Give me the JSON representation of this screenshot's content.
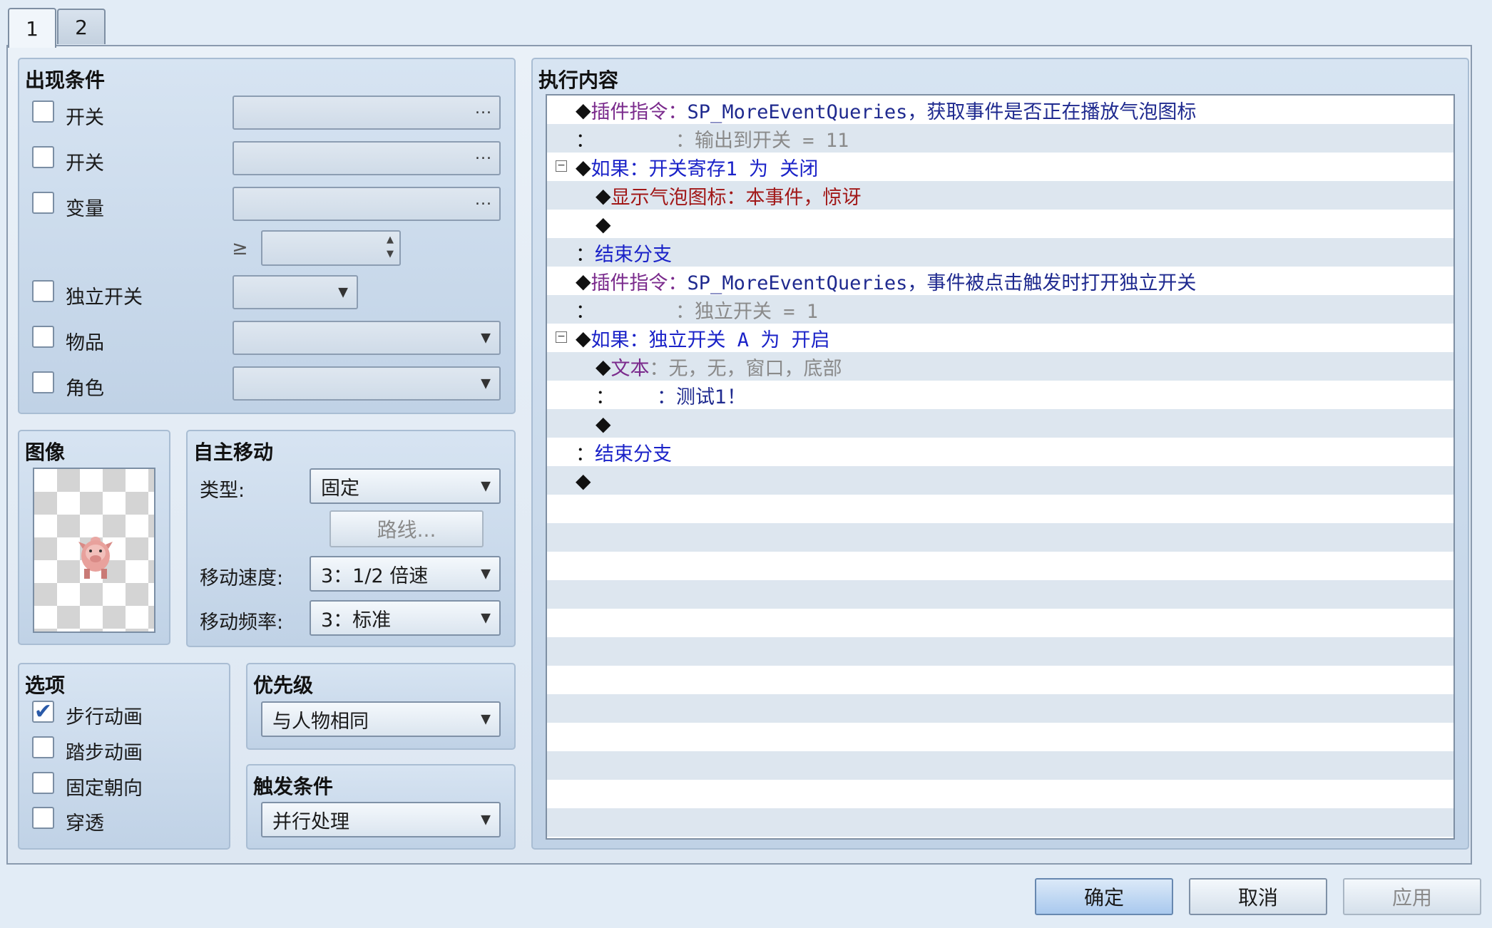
{
  "tabs": [
    "1",
    "2"
  ],
  "conditions": {
    "title": "出现条件",
    "switch1_label": "开关",
    "switch2_label": "开关",
    "variable_label": "变量",
    "ge_symbol": "≥",
    "self_switch_label": "独立开关",
    "item_label": "物品",
    "actor_label": "角色",
    "ellipsis": "..."
  },
  "image": {
    "title": "图像"
  },
  "autonomous": {
    "title": "自主移动",
    "type_label": "类型:",
    "type_value": "固定",
    "route_button": "路线...",
    "speed_label": "移动速度:",
    "speed_value": "3：1/2 倍速",
    "freq_label": "移动频率:",
    "freq_value": "3：标准"
  },
  "options": {
    "title": "选项",
    "walking": "步行动画",
    "walking_checked": "✔",
    "stepping": "踏步动画",
    "direction_fix": "固定朝向",
    "through": "穿透"
  },
  "priority": {
    "title": "优先级",
    "value": "与人物相同"
  },
  "trigger": {
    "title": "触发条件",
    "value": "并行处理"
  },
  "contents": {
    "title": "执行内容",
    "r1_cmd": "插件指令：",
    "r1_text": "SP_MoreEventQueries，获取事件是否正在播放气泡图标",
    "r2_colon": "：",
    "r2_text": "：输出到开关 = 11",
    "r3_cmd": "如果：",
    "r3_text": "开关寄存1 为 关闭",
    "r4_cmd": "显示气泡图标：",
    "r4_text": "本事件，惊讶",
    "r6_colon": "：",
    "r6_text": "结束分支",
    "r7_cmd": "插件指令：",
    "r7_text": "SP_MoreEventQueries，事件被点击触发时打开独立开关",
    "r8_colon": "：",
    "r8_text": "：独立开关 = 1",
    "r9_cmd": "如果：",
    "r9_text": "独立开关 A 为 开启",
    "r10_cmd": "文本",
    "r10_text": "：无，无，窗口，底部",
    "r11_colon": "：",
    "r11_text": "：测试1！",
    "r13_colon": "：",
    "r13_text": "结束分支",
    "diamond": "◆",
    "collapse": "−"
  },
  "buttons": {
    "ok": "确定",
    "cancel": "取消",
    "apply": "应用"
  }
}
